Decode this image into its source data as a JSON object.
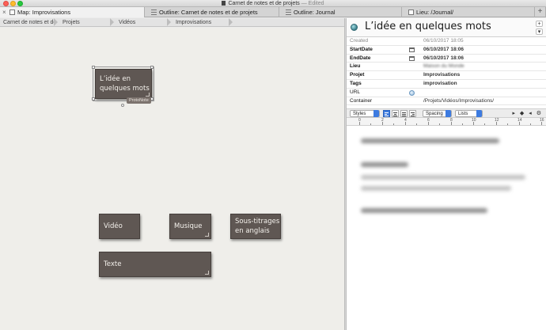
{
  "window": {
    "title": "Carnet de notes et de projets",
    "edited": "— Edited",
    "accent": "#3d7be0"
  },
  "tabs": [
    {
      "label": "Map: Improvisations",
      "active": true
    },
    {
      "label": "Outline: Carnet de notes et de projets",
      "active": false
    },
    {
      "label": "Outline: Journal",
      "active": false
    },
    {
      "label": "Lieu: /Journal/",
      "active": false
    }
  ],
  "breadcrumb": [
    "Carnet de notes et de pr...",
    "Projets",
    "Vidéos",
    "Improvisations"
  ],
  "map": {
    "notes": [
      {
        "title": "L’idée en quelques mots",
        "selected": true
      },
      {
        "title": "Vidéo"
      },
      {
        "title": "Musique"
      },
      {
        "title": "Sous-titrages en anglais"
      },
      {
        "title": "Texte"
      }
    ],
    "prototype_badge": "ProtoNote",
    "note_color": "#5f5753",
    "background": "#efeeea"
  },
  "inspector": {
    "title": "L’idée en quelques mots",
    "attributes": [
      {
        "name": "Created",
        "value": "06/10/2017 18:05"
      },
      {
        "name": "StartDate",
        "value": "06/10/2017 18:06"
      },
      {
        "name": "EndDate",
        "value": "06/10/2017 18:06"
      },
      {
        "name": "Lieu",
        "value": "Maison du Monde"
      },
      {
        "name": "Projet",
        "value": "Improvisations"
      },
      {
        "name": "Tags",
        "value": "improvisation"
      },
      {
        "name": "URL",
        "value": ""
      },
      {
        "name": "Container",
        "value": "/Projets/Vidéos/Improvisations/"
      }
    ],
    "format_bar": {
      "styles": "Styles",
      "spacing": "Spacing",
      "lists": "Lists",
      "nav": "▸ ◆ ◂ ⚙"
    },
    "ruler_numbers": [
      "0",
      "2",
      "4",
      "6",
      "8",
      "10",
      "12",
      "14",
      "16"
    ]
  }
}
